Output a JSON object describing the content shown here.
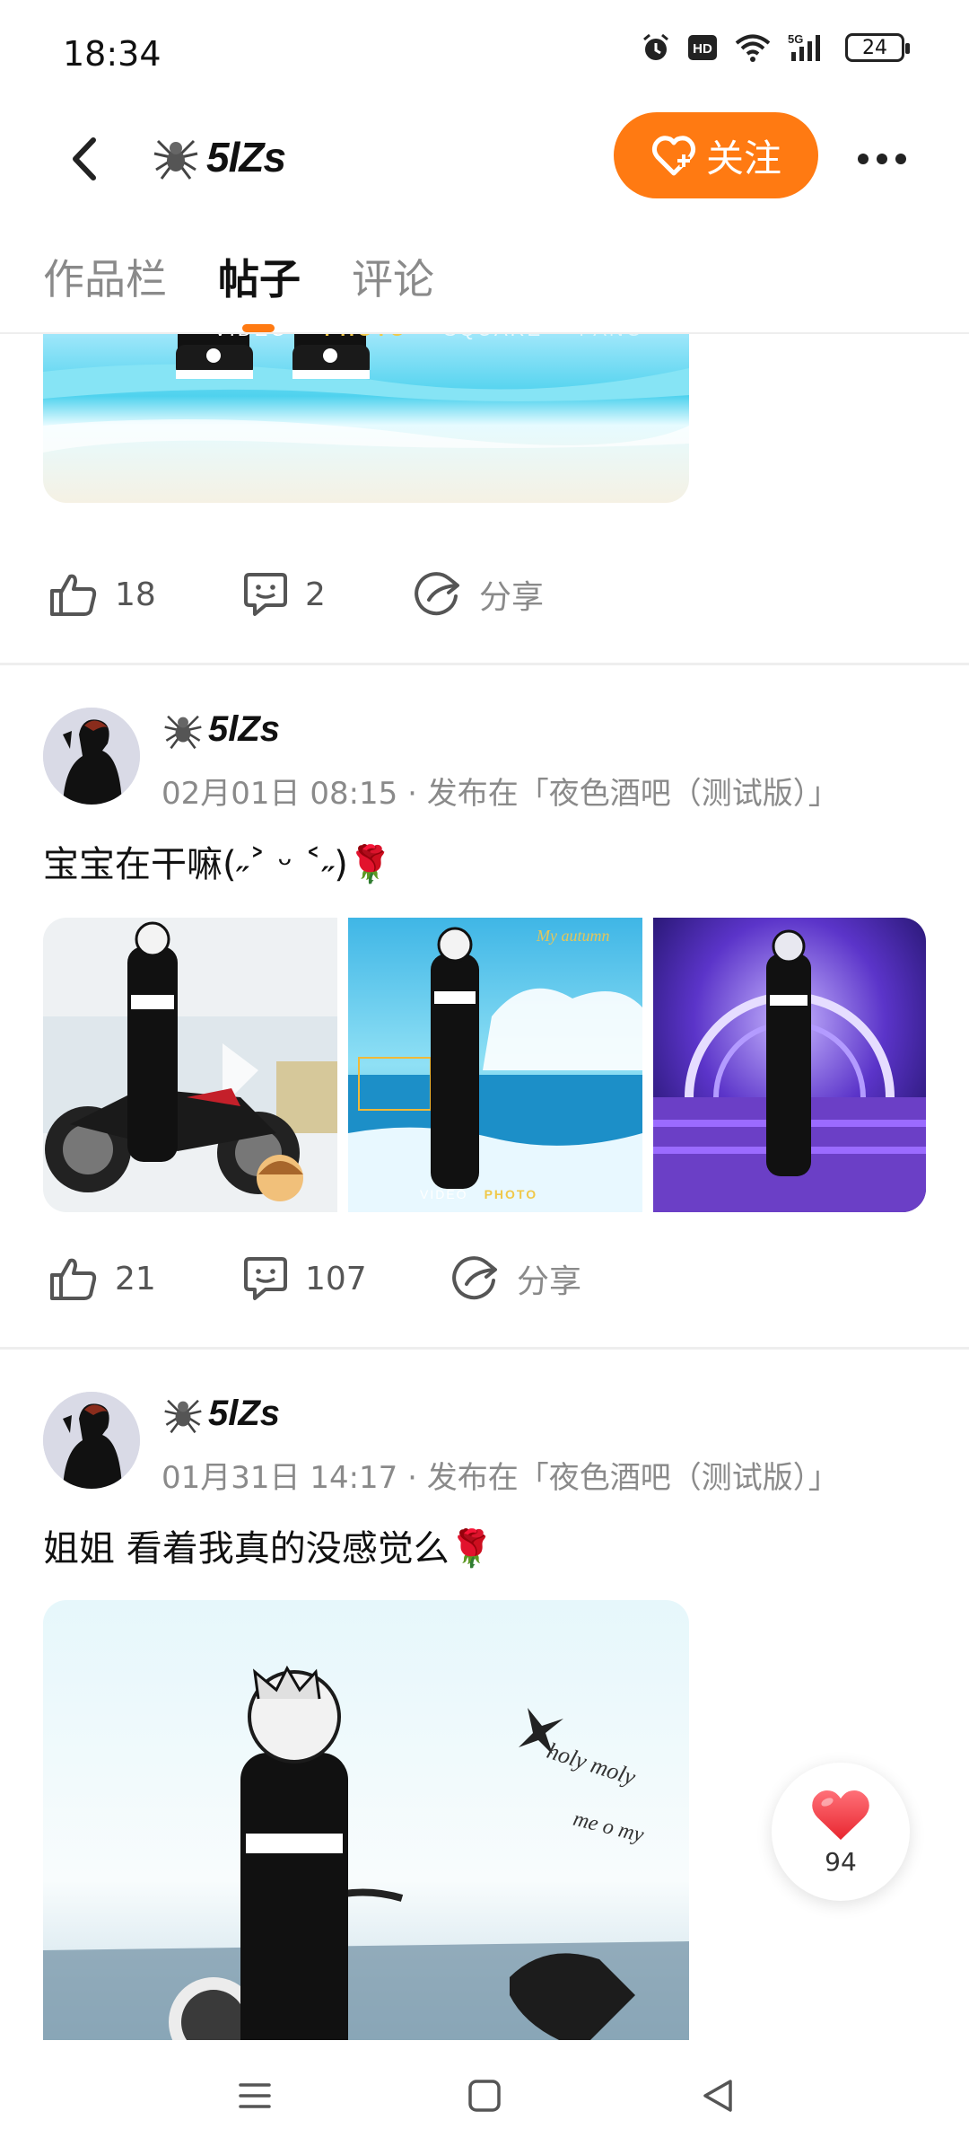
{
  "status_bar": {
    "time": "18:34",
    "network": "5G",
    "battery": "24"
  },
  "header": {
    "title": "5lZs",
    "follow_label": "关注"
  },
  "tabs": [
    {
      "label": "作品栏"
    },
    {
      "label": "帖子"
    },
    {
      "label": "评论"
    }
  ],
  "posts": [
    {
      "likes": "18",
      "comments": "2",
      "share_label": "分享"
    },
    {
      "author": "5lZs",
      "meta": "02月01日 08:15 · 发布在「夜色酒吧（测试版）」",
      "text": "宝宝在干嘛(˶˃ ᵕ ˂˶)🌹",
      "likes": "21",
      "comments": "107",
      "share_label": "分享"
    },
    {
      "author": "5lZs",
      "meta": "01月31日 14:17 · 发布在「夜色酒吧（测试版）」",
      "text": "姐姐 看着我真的没感觉么🌹"
    }
  ],
  "image_captions": {
    "camera_modes": [
      "VIDEO",
      "PHOTO",
      "SQUARE",
      "PANO"
    ],
    "camera_modes_small": [
      "VIDEO",
      "PHOTO"
    ],
    "sky_script": "My autumn",
    "handwriting": [
      "holy moly",
      "me o my"
    ]
  },
  "floating_like": {
    "count": "94"
  },
  "colors": {
    "accent": "#ff7a12",
    "text": "#111111",
    "muted": "#8a8a8a"
  }
}
